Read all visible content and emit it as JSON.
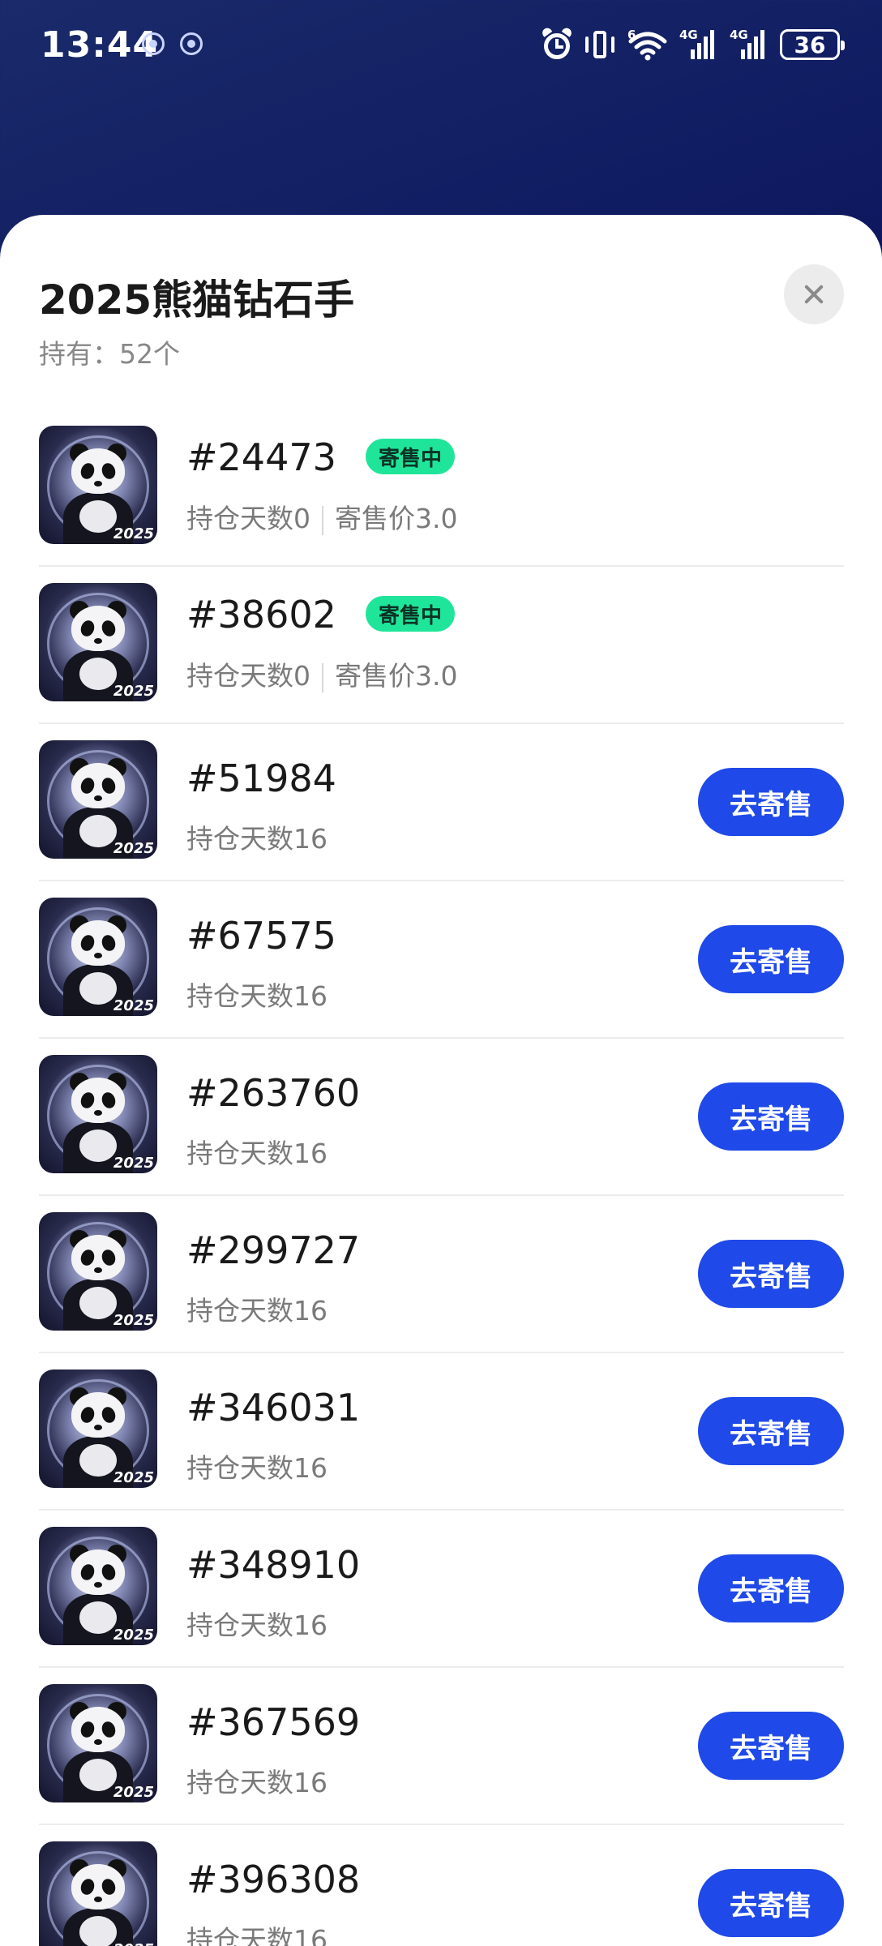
{
  "status_bar": {
    "time": "13:44",
    "network_label_1": "4G",
    "network_label_2": "4G",
    "wifi_label": "6",
    "battery": "36"
  },
  "sheet": {
    "title": "2025熊猫钻石手",
    "subtitle": "持有：52个"
  },
  "colors": {
    "accent_button": "#1f49e8",
    "badge_green": "#1fe59a",
    "background_gradient": "#08105a"
  },
  "items": [
    {
      "id": "#24473",
      "badge": "寄售中",
      "hold_days": "持仓天数0",
      "price": "寄售价3.0",
      "on_sale": true
    },
    {
      "id": "#38602",
      "badge": "寄售中",
      "hold_days": "持仓天数0",
      "price": "寄售价3.0",
      "on_sale": true
    },
    {
      "id": "#51984",
      "hold_days": "持仓天数16",
      "action": "去寄售",
      "on_sale": false
    },
    {
      "id": "#67575",
      "hold_days": "持仓天数16",
      "action": "去寄售",
      "on_sale": false
    },
    {
      "id": "#263760",
      "hold_days": "持仓天数16",
      "action": "去寄售",
      "on_sale": false
    },
    {
      "id": "#299727",
      "hold_days": "持仓天数16",
      "action": "去寄售",
      "on_sale": false
    },
    {
      "id": "#346031",
      "hold_days": "持仓天数16",
      "action": "去寄售",
      "on_sale": false
    },
    {
      "id": "#348910",
      "hold_days": "持仓天数16",
      "action": "去寄售",
      "on_sale": false
    },
    {
      "id": "#367569",
      "hold_days": "持仓天数16",
      "action": "去寄售",
      "on_sale": false
    },
    {
      "id": "#396308",
      "hold_days": "持仓天数16",
      "action": "去寄售",
      "on_sale": false
    }
  ],
  "thumb_year": "2025"
}
